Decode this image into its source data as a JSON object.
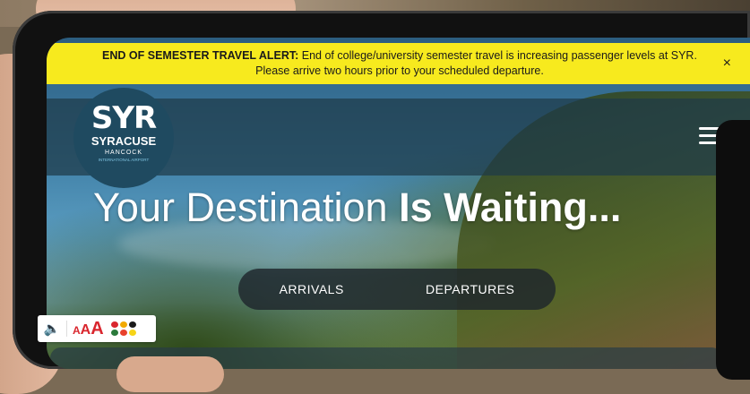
{
  "alert": {
    "title": "END OF SEMESTER TRAVEL ALERT:",
    "message": " End of college/university semester travel is increasing passenger levels at SYR. Please arrive two hours prior to your scheduled departure.",
    "close_label": "×"
  },
  "logo": {
    "syr": "SYR",
    "syracuse": "SYRACUSE",
    "hancock": "HANCOCK",
    "international": "INTERNATIONAL AIRPORT"
  },
  "hero": {
    "title_regular": "Your Destination ",
    "title_bold": "Is Waiting..."
  },
  "flight_toggle": {
    "arrivals": "ARRIVALS",
    "departures": "DEPARTURES"
  },
  "accessibility": {
    "speaker_icon": "speaker-icon",
    "text_size_small": "A",
    "text_size_medium": "A",
    "text_size_large": "A",
    "language_icon": "language-flags-icon"
  },
  "colors": {
    "alert_bg": "#f7ea1e",
    "header_bg": "#1e3a48",
    "accessibility_red": "#d9262e"
  }
}
